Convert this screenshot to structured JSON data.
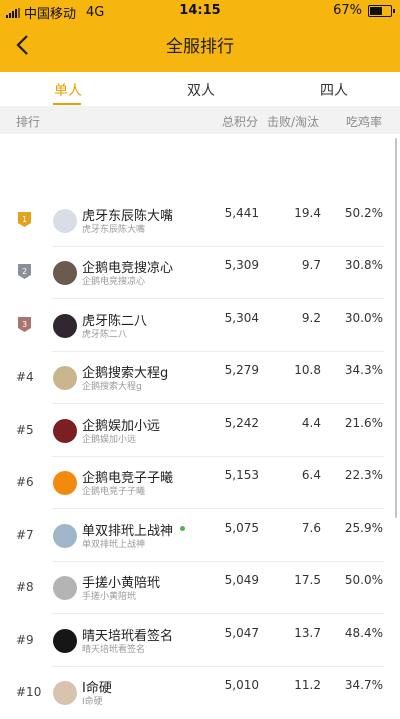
{
  "status": {
    "carrier": "中国移动",
    "network": "4G",
    "time": "14:15",
    "battery": "67%",
    "battery_level": 0.67
  },
  "nav": {
    "title": "全服排行"
  },
  "tabs": [
    {
      "label": "单人",
      "active": true
    },
    {
      "label": "双人",
      "active": false
    },
    {
      "label": "四人",
      "active": false
    }
  ],
  "columns": {
    "rank": "排行",
    "score": "总积分",
    "kills": "击败/淘汰",
    "rate": "吃鸡率"
  },
  "rows": [
    {
      "rank": "1",
      "medal": "gold",
      "name": "虎牙东辰陈大嘴",
      "sub": "虎牙东辰陈大嘴",
      "score": "5,441",
      "kills": "19.4",
      "rate": "50.2%",
      "avatar_color": "#d9dde6",
      "online": false
    },
    {
      "rank": "2",
      "medal": "silver",
      "name": "企鹅电竞搜凉心",
      "sub": "企鹅电竞搜凉心",
      "score": "5,309",
      "kills": "9.7",
      "rate": "30.8%",
      "avatar_color": "#6b5a4e",
      "online": false
    },
    {
      "rank": "3",
      "medal": "bronze",
      "name": "虎牙陈二八",
      "sub": "虎牙陈二八",
      "score": "5,304",
      "kills": "9.2",
      "rate": "30.0%",
      "avatar_color": "#2f2630",
      "online": false
    },
    {
      "rank": "#4",
      "medal": "",
      "name": "企鹅搜索大程g",
      "sub": "企鹅搜索大程g",
      "score": "5,279",
      "kills": "10.8",
      "rate": "34.3%",
      "avatar_color": "#c9b58e",
      "online": false
    },
    {
      "rank": "#5",
      "medal": "",
      "name": "企鹅娱加小远",
      "sub": "企鹅娱加小远",
      "score": "5,242",
      "kills": "4.4",
      "rate": "21.6%",
      "avatar_color": "#7a1f22",
      "online": false
    },
    {
      "rank": "#6",
      "medal": "",
      "name": "企鹅电竞子子曦",
      "sub": "企鹅电竞子子曦",
      "score": "5,153",
      "kills": "6.4",
      "rate": "22.3%",
      "avatar_color": "#f28a10",
      "online": false
    },
    {
      "rank": "#7",
      "medal": "",
      "name": "单双排玳上战神",
      "sub": "单双排玳上战神",
      "score": "5,075",
      "kills": "7.6",
      "rate": "25.9%",
      "avatar_color": "#9fb5c9",
      "online": true
    },
    {
      "rank": "#8",
      "medal": "",
      "name": "手搓小黄陪玳",
      "sub": "手搓小黄陪玳",
      "score": "5,049",
      "kills": "17.5",
      "rate": "50.0%",
      "avatar_color": "#b4b4b4",
      "online": false
    },
    {
      "rank": "#9",
      "medal": "",
      "name": "晴天培玳看签名",
      "sub": "晴天培玳看签名",
      "score": "5,047",
      "kills": "13.7",
      "rate": "48.4%",
      "avatar_color": "#161616",
      "online": false
    },
    {
      "rank": "#10",
      "medal": "",
      "name": "I命硬",
      "sub": "I命硬",
      "score": "5,010",
      "kills": "11.2",
      "rate": "34.7%",
      "avatar_color": "#d8c4ae",
      "online": false
    }
  ],
  "colors": {
    "accent": "#f6b50f",
    "active_tab": "#e7a000",
    "gold": "#e3a21a",
    "silver": "#8a8f99",
    "bronze": "#a8766b",
    "online": "#4cb84c"
  }
}
